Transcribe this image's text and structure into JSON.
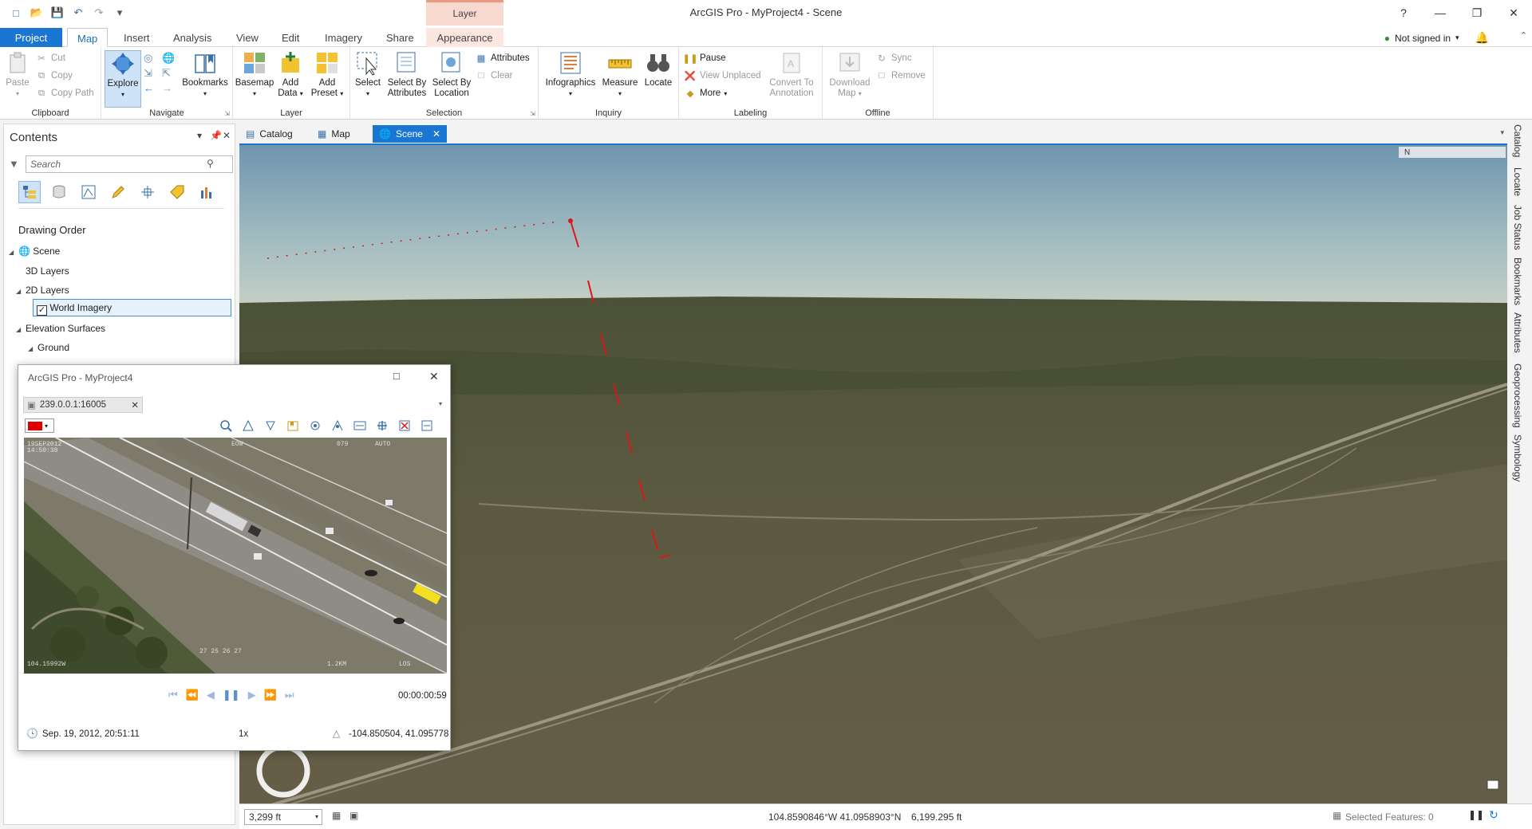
{
  "app": {
    "title": "ArcGIS Pro - MyProject4 - Scene",
    "context_tab_header": "Layer",
    "help": "?",
    "signin": "Not signed in"
  },
  "tabs": [
    "Project",
    "Map",
    "Insert",
    "Analysis",
    "View",
    "Edit",
    "Imagery",
    "Share",
    "Appearance"
  ],
  "ribbon": {
    "clipboard": {
      "label": "Clipboard",
      "paste": "Paste",
      "cut": "Cut",
      "copy": "Copy",
      "copy_path": "Copy Path"
    },
    "navigate": {
      "label": "Navigate",
      "explore": "Explore",
      "bookmarks": "Bookmarks"
    },
    "layer": {
      "label": "Layer",
      "basemap": "Basemap",
      "add_data": "Add Data",
      "add_preset": "Add Preset"
    },
    "selection": {
      "label": "Selection",
      "select": "Select",
      "select_by_attributes": "Select By Attributes",
      "select_by_location": "Select By Location",
      "attributes": "Attributes",
      "clear": "Clear"
    },
    "inquiry": {
      "label": "Inquiry",
      "infographics": "Infographics",
      "measure": "Measure",
      "locate": "Locate"
    },
    "labeling": {
      "label": "Labeling",
      "pause": "Pause",
      "view_unplaced": "View Unplaced",
      "more": "More",
      "convert_to_annotation": "Convert To Annotation"
    },
    "offline": {
      "label": "Offline",
      "download_map": "Download Map",
      "sync": "Sync",
      "remove": "Remove"
    }
  },
  "contents": {
    "title": "Contents",
    "search_placeholder": "Search",
    "drawing_order": "Drawing Order",
    "tree": {
      "scene": "Scene",
      "layers_3d": "3D Layers",
      "layers_2d": "2D Layers",
      "world_imagery": "World Imagery",
      "elevation_surfaces": "Elevation Surfaces",
      "ground": "Ground"
    }
  },
  "view_tabs": [
    "Catalog",
    "Map",
    "Scene"
  ],
  "dock": [
    "Catalog",
    "Locate",
    "Job Status",
    "Bookmarks",
    "Attributes",
    "Geoprocessing",
    "Symbology"
  ],
  "player": {
    "title": "ArcGIS Pro - MyProject4",
    "stream_tab": "239.0.0.1:16005",
    "color": "#e00000",
    "elapsed": "00:00:00:59",
    "datetime": "Sep. 19, 2012, 20:51:11",
    "speed": "1x",
    "coordinates": "-104.850504, 41.095778"
  },
  "status": {
    "scale": "3,299 ft",
    "location": "104.8590846°W 41.0958903°N",
    "elevation": "6,199.295 ft",
    "selected_features": "Selected Features: 0"
  },
  "scene": {
    "north_label": "N"
  }
}
